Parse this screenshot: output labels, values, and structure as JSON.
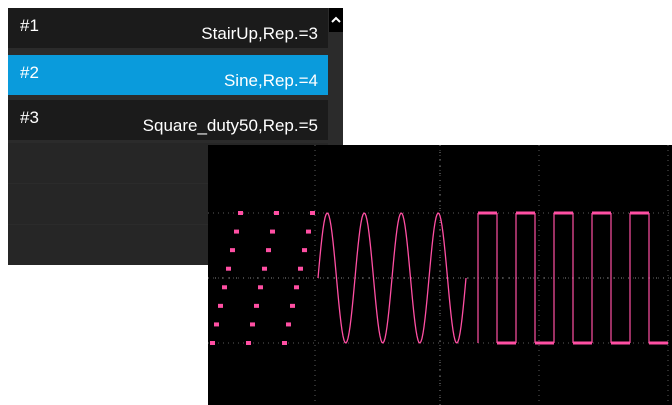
{
  "sequence_list": {
    "items": [
      {
        "num": "#1",
        "label": "StairUp,Rep.=3",
        "selected": false
      },
      {
        "num": "#2",
        "label": "Sine,Rep.=4",
        "selected": true
      },
      {
        "num": "#3",
        "label": "Square_duty50,Rep.=5",
        "selected": false
      }
    ],
    "scroll_up_icon": "chevron-up-icon"
  },
  "scope": {
    "trace_color": "#ff4fa3",
    "grid_color": "#5a5a5a"
  }
}
